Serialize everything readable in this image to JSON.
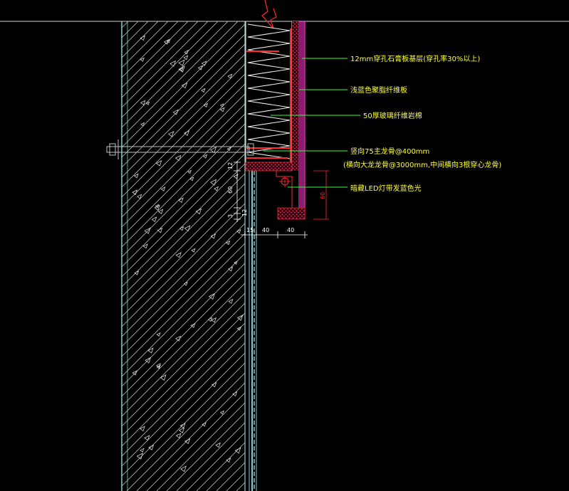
{
  "colors": {
    "background": "#000000",
    "concrete_outline": "#7fd0d0",
    "hatch": "#d8d8d8",
    "annotation_text": "#ffff33",
    "leader": "#33ff33",
    "detail_red": "#ff2a2a",
    "detail_magenta": "#ff33cc",
    "wool": "#f2f2f2",
    "dimension": "#ffffff",
    "bolt": "#bfbfbf"
  },
  "annotations": [
    "12mm穿孔石膏板基层(穿孔率30%以上)",
    "浅蓝色聚脂纤维板",
    "50厚玻璃纤维岩棉",
    "竖向75主龙骨@400mm",
    "(横向大龙龙骨@3000mm,中间横向3根穿心龙骨)",
    "暗藏LED灯带发蓝色光"
  ],
  "dimensions": {
    "vertical": [
      "12",
      "60",
      "3",
      "12"
    ],
    "horizontal": [
      "15",
      "40",
      "40"
    ],
    "pocket_height": "60"
  }
}
